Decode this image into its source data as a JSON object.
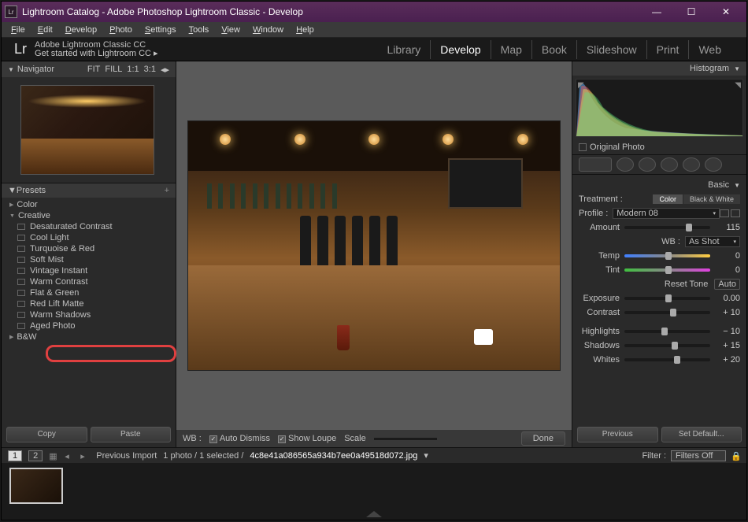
{
  "window": {
    "title": "Lightroom Catalog - Adobe Photoshop Lightroom Classic - Develop"
  },
  "menu": [
    "File",
    "Edit",
    "Develop",
    "Photo",
    "Settings",
    "Tools",
    "View",
    "Window",
    "Help"
  ],
  "brand": {
    "logo": "Lr",
    "tag1": "Adobe Lightroom Classic CC",
    "tag2": "Get started with Lightroom CC  ▸"
  },
  "modules": {
    "items": [
      "Library",
      "Develop",
      "Map",
      "Book",
      "Slideshow",
      "Print",
      "Web"
    ],
    "active": "Develop"
  },
  "navigator": {
    "title": "Navigator",
    "opts": [
      "FIT",
      "FILL",
      "1:1",
      "3:1"
    ]
  },
  "presets": {
    "title": "Presets",
    "groups": [
      {
        "label": "Color",
        "open": false
      },
      {
        "label": "Creative",
        "open": true,
        "items": [
          "Desaturated Contrast",
          "Cool Light",
          "Turquoise & Red",
          "Soft Mist",
          "Vintage Instant",
          "Warm Contrast",
          "Flat & Green",
          "Red Lift Matte",
          "Warm Shadows",
          "Aged Photo"
        ]
      },
      {
        "label": "B&W",
        "open": false
      }
    ],
    "highlighted": "Red Lift Matte"
  },
  "buttons": {
    "copy": "Copy",
    "paste": "Paste",
    "previous": "Previous",
    "setdefault": "Set Default...",
    "done": "Done"
  },
  "wb_toolbar": {
    "label": "WB :",
    "autodismiss": "Auto Dismiss",
    "showloupe": "Show Loupe",
    "scale": "Scale"
  },
  "histogram": {
    "title": "Histogram",
    "original": "Original Photo"
  },
  "basic": {
    "title": "Basic",
    "treatment_label": "Treatment :",
    "treatment_color": "Color",
    "treatment_bw": "Black & White",
    "profile_label": "Profile :",
    "profile_value": "Modern 08",
    "amount_label": "Amount",
    "amount_value": "115",
    "wb_label": "WB :",
    "wb_value": "As Shot",
    "temp_label": "Temp",
    "temp_value": "0",
    "tint_label": "Tint",
    "tint_value": "0",
    "reset": "Reset Tone",
    "auto": "Auto",
    "sliders": [
      {
        "label": "Exposure",
        "value": "0.00",
        "pos": 50
      },
      {
        "label": "Contrast",
        "value": "+ 10",
        "pos": 55
      },
      {
        "label": "Highlights",
        "value": "− 10",
        "pos": 45
      },
      {
        "label": "Shadows",
        "value": "+ 15",
        "pos": 57
      },
      {
        "label": "Whites",
        "value": "+ 20",
        "pos": 60
      }
    ]
  },
  "filmstrip": {
    "source_label": "Previous Import",
    "count": "1 photo / 1 selected /",
    "filename": "4c8e41a086565a934b7ee0a49518d072.jpg",
    "filter_label": "Filter :",
    "filter_value": "Filters Off"
  }
}
